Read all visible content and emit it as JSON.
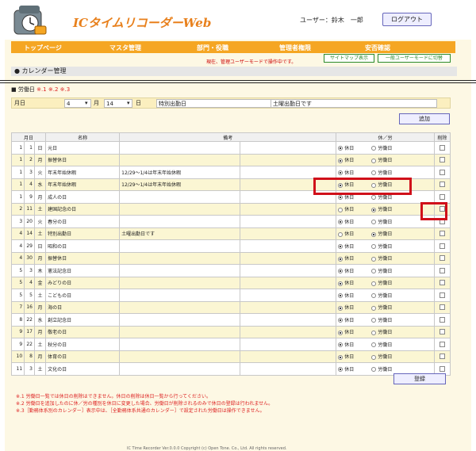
{
  "header": {
    "title": "ICタイムリコーダーWeb",
    "user": "ユーザー：鈴木　一郎",
    "logout": "ログアウト"
  },
  "nav": [
    "トップページ",
    "マスタ管理",
    "部門・役職",
    "管理者権限",
    "安否確認"
  ],
  "mode_text": "現在、管理ユーザーモードで操作中です。",
  "buttons": {
    "sitemap": "サイトマップ表示",
    "user_mode": "一般ユーザーモードに切替",
    "add": "追加",
    "register": "登録"
  },
  "section_title": "カレンダー管理",
  "sub_head": {
    "label": "■ 労働日",
    "marks": "※.1 ※.2 ※.3"
  },
  "form": {
    "label": "月日",
    "month": "4",
    "month_unit": "月",
    "day": "14",
    "day_unit": "日",
    "name": "特別出勤日",
    "note": "土曜出勤日です"
  },
  "table": {
    "headers": [
      "月日",
      "名称",
      "備考",
      "休／労",
      "削除"
    ],
    "radio_labels": [
      "休日",
      "労働日"
    ],
    "rows": [
      [
        "1",
        "1",
        "日",
        "元日",
        "",
        0
      ],
      [
        "1",
        "2",
        "月",
        "振替休日",
        "",
        0
      ],
      [
        "1",
        "3",
        "火",
        "年末年始休暇",
        "12/29～1/4は年末年始休暇",
        0
      ],
      [
        "1",
        "4",
        "水",
        "年末年始休暇",
        "12/29～1/4は年末年始休暇",
        0
      ],
      [
        "1",
        "9",
        "月",
        "成人の日",
        "",
        0
      ],
      [
        "2",
        "11",
        "土",
        "建国記念の日",
        "",
        1
      ],
      [
        "3",
        "20",
        "火",
        "春分の日",
        "",
        0
      ],
      [
        "4",
        "14",
        "土",
        "特別出勤日",
        "土曜出勤日です",
        1
      ],
      [
        "4",
        "29",
        "日",
        "昭和の日",
        "",
        0
      ],
      [
        "4",
        "30",
        "月",
        "振替休日",
        "",
        0
      ],
      [
        "5",
        "3",
        "木",
        "憲法記念日",
        "",
        0
      ],
      [
        "5",
        "4",
        "金",
        "みどりの日",
        "",
        0
      ],
      [
        "5",
        "5",
        "土",
        "こどもの日",
        "",
        0
      ],
      [
        "7",
        "16",
        "月",
        "海の日",
        "",
        0
      ],
      [
        "8",
        "22",
        "水",
        "創立記念日",
        "",
        0
      ],
      [
        "9",
        "17",
        "月",
        "敬老の日",
        "",
        0
      ],
      [
        "9",
        "22",
        "土",
        "秋分の日",
        "",
        0
      ],
      [
        "10",
        "8",
        "月",
        "体育の日",
        "",
        0
      ],
      [
        "11",
        "3",
        "土",
        "文化の日",
        "",
        0
      ]
    ]
  },
  "notes": [
    "※.1 労働日一覧では休日の削除はできません。休日の削除は休日一覧から行ってください。",
    "※.2 労働日を追加したのに休／労の種別を休日に変更した場合、労働日が削除されるのみで休日の登録は行われません。",
    "※.3［勤務体系別のカレンダー］表示中は、［全勤務体系共通のカレンダー］で設定された労働日は操作できません。"
  ],
  "footer": "IC Time Recorder Ver.0.0.0 Copyright (c) Open Tone. Co., Ltd. All rights reserved.",
  "colors": {
    "accent": "#f5a623",
    "title": "#e8801c",
    "highlight": "#d0101a"
  }
}
